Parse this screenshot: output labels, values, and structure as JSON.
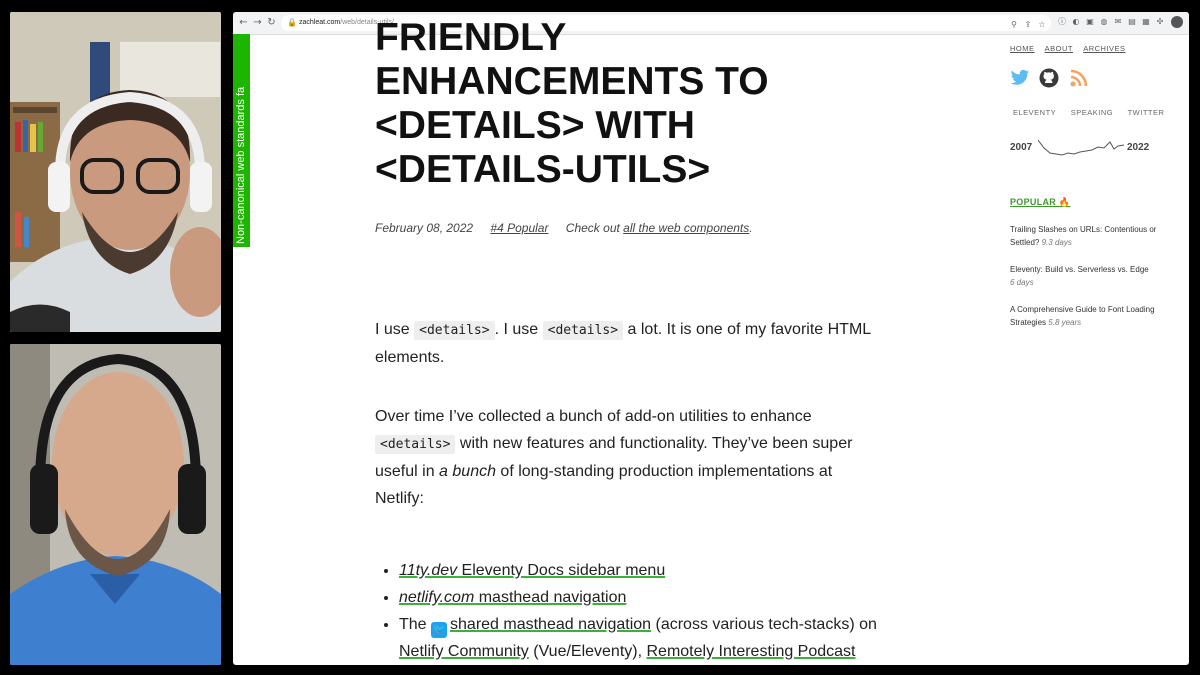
{
  "browser": {
    "url_host": "zachleat.com",
    "url_path": "/web/details-utils/"
  },
  "banner": {
    "text": "Non-canonical web standards fa"
  },
  "article": {
    "title_lines": [
      "FRIENDLY",
      "ENHANCEMENTS TO",
      "<DETAILS> WITH",
      "<DETAILS-UTILS>"
    ],
    "date": "February 08, 2022",
    "popular_tag": "#4 Popular",
    "checkout_prefix": "Check out ",
    "checkout_link": "all the web components",
    "checkout_suffix": ".",
    "p1": {
      "t1": "I use ",
      "code1": "<details>",
      "t2": ". I use ",
      "code2": "<details>",
      "t3": " a lot. It is one of my favorite HTML elements."
    },
    "p2": {
      "t1": "Over time I’ve collected a bunch of add-on utilities to enhance ",
      "code1": "<details>",
      "t2": " with new features and functionality. They’ve been super useful in ",
      "em": "a bunch",
      "t3": " of long-standing production implementations at Netlify:"
    },
    "list": [
      {
        "em": "11ty.dev",
        "text": " Eleventy Docs sidebar menu"
      },
      {
        "em": "netlify.com",
        "text": " masthead navigation"
      },
      {
        "pre": "The ",
        "link": "shared masthead navigation",
        "mid": " (across various tech-stacks) on ",
        "link2": "Netlify Community",
        "mid2": " (Vue/Eleventy), ",
        "link3": "Remotely Interesting Podcast"
      }
    ]
  },
  "sidebar": {
    "nav": [
      "HOME",
      "ABOUT",
      "ARCHIVES"
    ],
    "social_icons": [
      "twitter-icon",
      "github-icon",
      "rss-icon"
    ],
    "categories": [
      "ELEVENTY",
      "SPEAKING",
      "TWITTER"
    ],
    "year_start": "2007",
    "year_end": "2022",
    "popular_heading": "POPULAR 🔥",
    "popular": [
      {
        "title": "Trailing Slashes on URLs: Contentious or Settled?",
        "age": "9.3 days"
      },
      {
        "title": "Eleventy: Build vs. Serverless vs. Edge",
        "age": "6 days"
      },
      {
        "title": "A Comprehensive Guide to Font Loading Strategies",
        "age": "5.8 years"
      }
    ]
  },
  "colors": {
    "link_underline": "#3bb13b",
    "banner": "#1eb500",
    "twitter": "#1da1f2",
    "rss": "#f4a261"
  }
}
